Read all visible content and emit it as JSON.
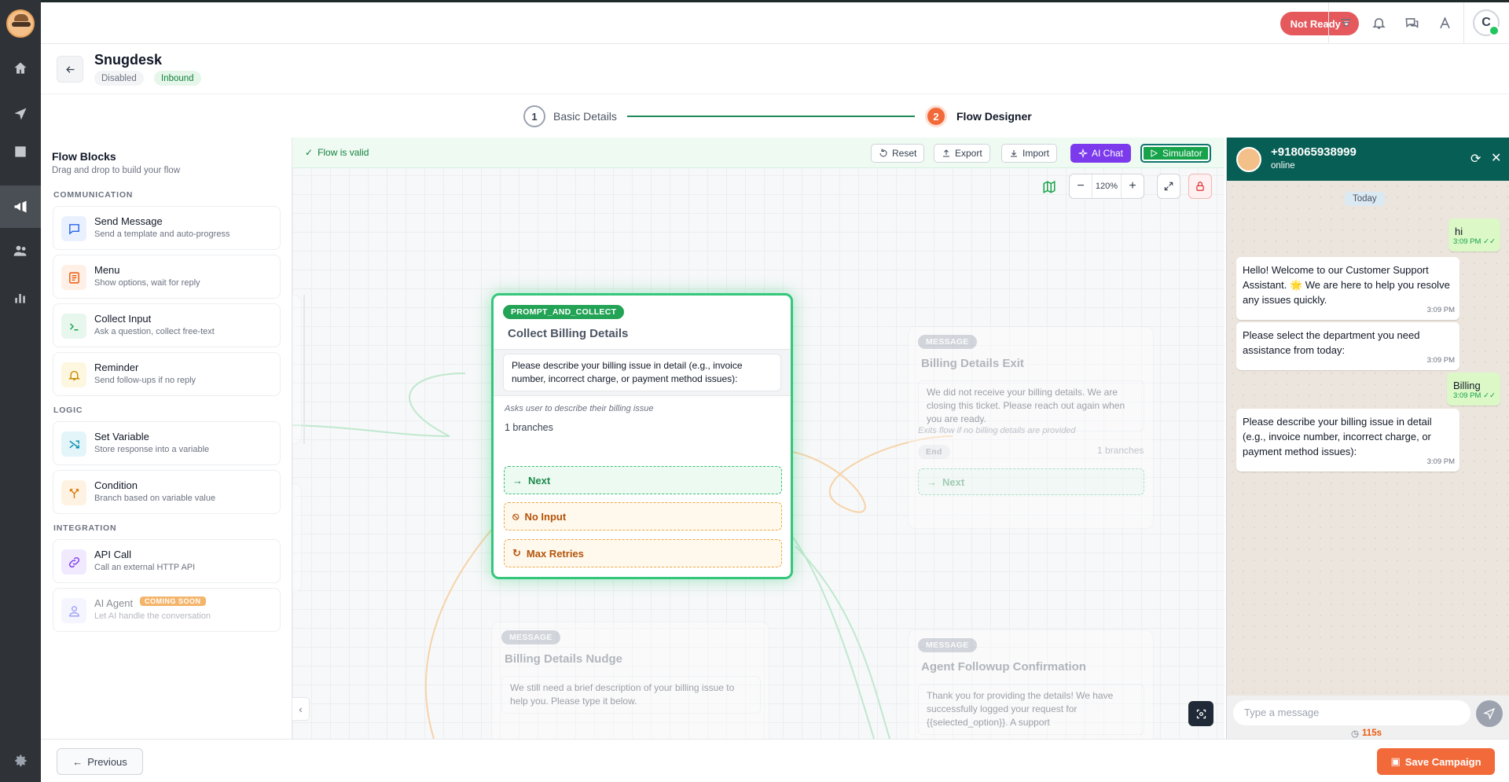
{
  "topbar": {
    "status_label": "Not Ready",
    "avatar_initial": "C"
  },
  "campaign": {
    "name": "Snugdesk",
    "status_badge": "Disabled",
    "type_badge": "Inbound"
  },
  "stepper": {
    "steps": [
      {
        "number": "1",
        "label": "Basic Details"
      },
      {
        "number": "2",
        "label": "Flow Designer"
      }
    ]
  },
  "sidebar": {
    "title": "Flow Blocks",
    "subtitle": "Drag and drop to build your flow",
    "sections": {
      "communication": "COMMUNICATION",
      "logic": "LOGIC",
      "integration": "INTEGRATION"
    },
    "blocks": [
      {
        "title": "Send Message",
        "subtitle": "Send a template and auto-progress",
        "icon": "message-icon",
        "color": "#2563eb"
      },
      {
        "title": "Menu",
        "subtitle": "Show options, wait for reply",
        "icon": "list-icon",
        "color": "#ea580c"
      },
      {
        "title": "Collect Input",
        "subtitle": "Ask a question, collect free-text",
        "icon": "terminal-icon",
        "color": "#16a34a"
      },
      {
        "title": "Reminder",
        "subtitle": "Send follow-ups if no reply",
        "icon": "bell-icon",
        "color": "#ca8a04"
      },
      {
        "title": "Set Variable",
        "subtitle": "Store response into a variable",
        "icon": "shuffle-icon",
        "color": "#0891b2"
      },
      {
        "title": "Condition",
        "subtitle": "Branch based on variable value",
        "icon": "branch-icon",
        "color": "#d97706"
      },
      {
        "title": "API Call",
        "subtitle": "Call an external HTTP API",
        "icon": "link-icon",
        "color": "#7c3aed"
      },
      {
        "title": "AI Agent",
        "subtitle": "Let AI handle the conversation",
        "icon": "user-icon",
        "color": "#6366f1",
        "badge": "COMING SOON"
      }
    ]
  },
  "canvas": {
    "valid_text": "Flow is valid",
    "toolbar": {
      "reset": "Reset",
      "export": "Export",
      "import": "Import",
      "ai_chat": "AI Chat",
      "simulator": "Simulator"
    },
    "zoom": "120%",
    "main_node": {
      "tag": "PROMPT_AND_COLLECT",
      "title": "Collect Billing Details",
      "message": "Please describe your billing issue in detail (e.g., invoice number, incorrect charge, or payment method issues):",
      "note": "Asks user to describe their billing issue",
      "branches_count": "1 branches",
      "branches": [
        "Next",
        "No Input",
        "Max Retries"
      ]
    },
    "exit_node": {
      "tag": "MESSAGE",
      "title": "Billing Details Exit",
      "message": "We did not receive your billing details. We are closing this ticket. Please reach out again when you are ready.",
      "note": "Exits flow if no billing details are provided",
      "end": "End",
      "branches_count": "1 branches",
      "branch": "Next"
    },
    "nudge_node": {
      "tag": "MESSAGE",
      "title": "Billing Details Nudge",
      "message": "We still need a brief description of your billing issue to help you. Please type it below."
    },
    "followup_node": {
      "tag": "MESSAGE",
      "title": "Agent Followup Confirmation",
      "message": "Thank you for providing the details! We have successfully logged your request for {{selected_option}}. A support"
    }
  },
  "simulator": {
    "phone": "+918065938999",
    "status": "online",
    "date_chip": "Today",
    "messages": [
      {
        "dir": "out",
        "text": "hi",
        "time": "3:09 PM ✓✓"
      },
      {
        "dir": "in",
        "text": "Hello! Welcome to our Customer Support Assistant. 🌟 We are here to help you resolve any issues quickly.",
        "time": "3:09 PM"
      },
      {
        "dir": "in",
        "text": "Please select the department you need assistance from today:",
        "time": "3:09 PM"
      },
      {
        "dir": "out",
        "text": "Billing",
        "time": "3:09 PM ✓✓"
      },
      {
        "dir": "in",
        "text": "Please describe your billing issue in detail (e.g., invoice number, incorrect charge, or payment method issues):",
        "time": "3:09 PM"
      }
    ],
    "input_placeholder": "Type a message",
    "timer": "115s"
  },
  "footer": {
    "previous": "Previous",
    "save": "Save Campaign"
  }
}
